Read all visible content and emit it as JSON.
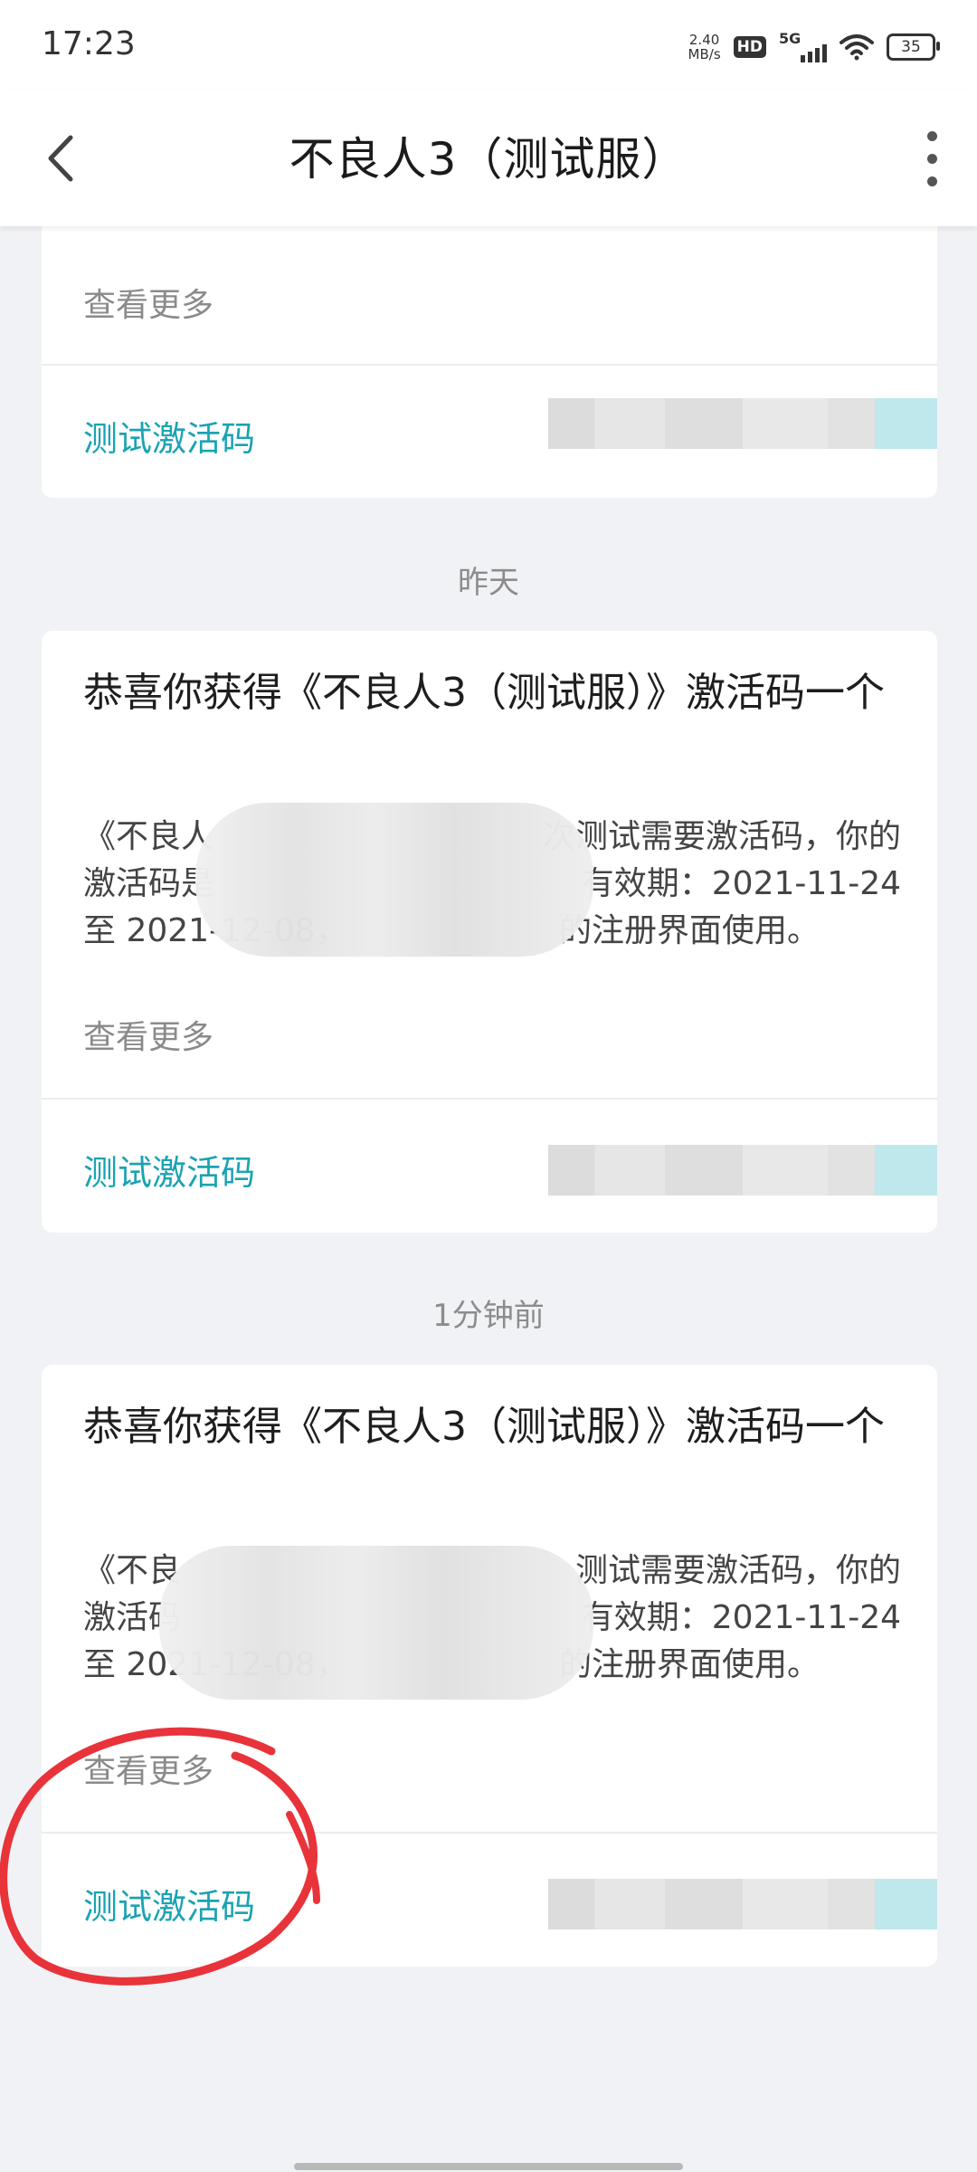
{
  "status_bar": {
    "time": "17:23",
    "net_speed_value": "2.40",
    "net_speed_unit": "MB/s",
    "hd_badge": "HD",
    "network_type": "5G",
    "battery_level": "35"
  },
  "header": {
    "title": "不良人3（测试服）"
  },
  "colors": {
    "accent": "#1aa3b3",
    "annotation": "#e8333a",
    "background": "#f1f2f5"
  },
  "messages": [
    {
      "view_more": "查看更多",
      "code_label": "测试激活码"
    },
    {
      "date": "昨天",
      "title": "恭喜你获得《不良人3（测试服）》激活码一个",
      "body_lines": [
        "《不良人",
        "次测试需要激活码，你的",
        "激活码是",
        "有效期：2021-11-24",
        "至 2021-12-08，",
        "的注册界面使用。"
      ],
      "view_more": "查看更多",
      "code_label": "测试激活码"
    },
    {
      "date": "1分钟前",
      "title": "恭喜你获得《不良人3（测试服）》激活码一个",
      "body_lines": [
        "《不良",
        "测试需要激活码，你的",
        "激活码",
        "有效期：2021-11-24",
        "至 2021-12-08，",
        "的注册界面使用。"
      ],
      "view_more": "查看更多",
      "code_label": "测试激活码"
    }
  ]
}
